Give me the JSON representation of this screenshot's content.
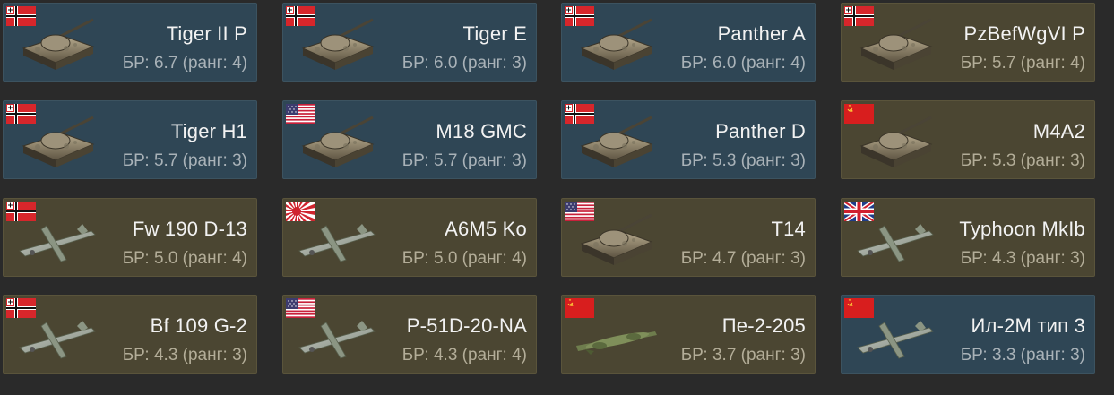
{
  "cards": [
    {
      "name": "Tiger II P",
      "br": "БР: 6.7 (ранг: 4)",
      "nation": "germany",
      "kind": "tank",
      "bg": "tank"
    },
    {
      "name": "Tiger E",
      "br": "БР: 6.0 (ранг: 3)",
      "nation": "germany",
      "kind": "tank",
      "bg": "tank"
    },
    {
      "name": "Panther A",
      "br": "БР: 6.0 (ранг: 4)",
      "nation": "germany",
      "kind": "tank",
      "bg": "tank"
    },
    {
      "name": "PzBefWgVI P",
      "br": "БР: 5.7 (ранг: 4)",
      "nation": "germany",
      "kind": "tank",
      "bg": "air"
    },
    {
      "name": "Tiger H1",
      "br": "БР: 5.7 (ранг: 3)",
      "nation": "germany",
      "kind": "tank",
      "bg": "tank"
    },
    {
      "name": "M18 GMC",
      "br": "БР: 5.7 (ранг: 3)",
      "nation": "usa",
      "kind": "tank",
      "bg": "tank"
    },
    {
      "name": "Panther D",
      "br": "БР: 5.3 (ранг: 3)",
      "nation": "germany",
      "kind": "tank",
      "bg": "tank"
    },
    {
      "name": "M4A2",
      "br": "БР: 5.3 (ранг: 3)",
      "nation": "ussr",
      "kind": "tank",
      "bg": "air"
    },
    {
      "name": "Fw 190 D-13",
      "br": "БР: 5.0 (ранг: 4)",
      "nation": "germany",
      "kind": "plane",
      "bg": "air"
    },
    {
      "name": "A6M5 Ko",
      "br": "БР: 5.0 (ранг: 4)",
      "nation": "japan",
      "kind": "plane",
      "bg": "air"
    },
    {
      "name": "T14",
      "br": "БР: 4.7 (ранг: 3)",
      "nation": "usa",
      "kind": "tank",
      "bg": "air"
    },
    {
      "name": "Typhoon MkIb",
      "br": "БР: 4.3 (ранг: 3)",
      "nation": "uk",
      "kind": "plane",
      "bg": "air"
    },
    {
      "name": "Bf 109 G-2",
      "br": "БР: 4.3 (ранг: 3)",
      "nation": "germany",
      "kind": "plane",
      "bg": "air"
    },
    {
      "name": "P-51D-20-NA",
      "br": "БР: 4.3 (ранг: 4)",
      "nation": "usa",
      "kind": "plane",
      "bg": "air"
    },
    {
      "name": "Пе-2-205",
      "br": "БР: 3.7 (ранг: 3)",
      "nation": "ussr",
      "kind": "bomber",
      "bg": "air"
    },
    {
      "name": "Ил-2М тип 3",
      "br": "БР: 3.3 (ранг: 3)",
      "nation": "ussr",
      "kind": "plane",
      "bg": "blue"
    }
  ],
  "colors": {
    "tank_card_bg": "#2f4655",
    "air_card_bg": "#4b4632",
    "page_bg": "#2a2a2a",
    "name_text": "#f2f2f2",
    "br_text": "#a9b2b8"
  }
}
